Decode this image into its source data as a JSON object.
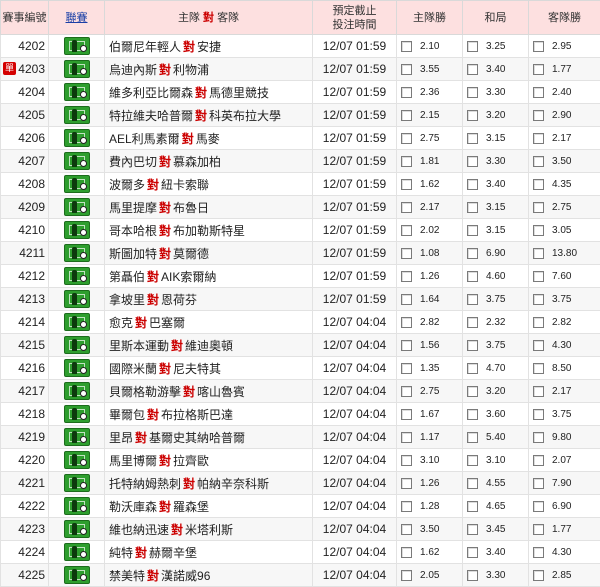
{
  "header": {
    "no": "賽事編號",
    "league": "聯賽",
    "match_pre": "主隊",
    "vs": "對",
    "match_post": "客隊",
    "time_line1": "預定截止",
    "time_line2": "投注時間",
    "home": "主隊勝",
    "draw": "和局",
    "away": "客隊勝"
  },
  "icons": {
    "league": "soccer-league-icon",
    "single": "single-match-badge"
  },
  "rows": [
    {
      "no": "4202",
      "single": "",
      "home": "伯爾尼年輕人",
      "away": "安捷",
      "time": "12/07 01:59",
      "h": "2.10",
      "d": "3.25",
      "a": "2.95"
    },
    {
      "no": "4203",
      "single": "單",
      "home": "烏迪內斯",
      "away": "利物浦",
      "time": "12/07 01:59",
      "h": "3.55",
      "d": "3.40",
      "a": "1.77"
    },
    {
      "no": "4204",
      "single": "",
      "home": "維多利亞比爾森",
      "away": "馬德里競技",
      "time": "12/07 01:59",
      "h": "2.36",
      "d": "3.30",
      "a": "2.40"
    },
    {
      "no": "4205",
      "single": "",
      "home": "特拉維夫哈普爾",
      "away": "科英布拉大學",
      "time": "12/07 01:59",
      "h": "2.15",
      "d": "3.20",
      "a": "2.90"
    },
    {
      "no": "4206",
      "single": "",
      "home": "AEL利馬素爾",
      "away": "馬麥",
      "time": "12/07 01:59",
      "h": "2.75",
      "d": "3.15",
      "a": "2.17"
    },
    {
      "no": "4207",
      "single": "",
      "home": "費內巴切",
      "away": "慕森加柏",
      "time": "12/07 01:59",
      "h": "1.81",
      "d": "3.30",
      "a": "3.50"
    },
    {
      "no": "4208",
      "single": "",
      "home": "波爾多",
      "away": "紐卡索聯",
      "time": "12/07 01:59",
      "h": "1.62",
      "d": "3.40",
      "a": "4.35"
    },
    {
      "no": "4209",
      "single": "",
      "home": "馬里提摩",
      "away": "布魯日",
      "time": "12/07 01:59",
      "h": "2.17",
      "d": "3.15",
      "a": "2.75"
    },
    {
      "no": "4210",
      "single": "",
      "home": "哥本哈根",
      "away": "布加勒斯特星",
      "time": "12/07 01:59",
      "h": "2.02",
      "d": "3.15",
      "a": "3.05"
    },
    {
      "no": "4211",
      "single": "",
      "home": "斯圖加特",
      "away": "莫爾德",
      "time": "12/07 01:59",
      "h": "1.08",
      "d": "6.90",
      "a": "13.80"
    },
    {
      "no": "4212",
      "single": "",
      "home": "第聶伯",
      "away": "AIK索爾納",
      "time": "12/07 01:59",
      "h": "1.26",
      "d": "4.60",
      "a": "7.60"
    },
    {
      "no": "4213",
      "single": "",
      "home": "拿坡里",
      "away": "恩荷芬",
      "time": "12/07 01:59",
      "h": "1.64",
      "d": "3.75",
      "a": "3.75"
    },
    {
      "no": "4214",
      "single": "",
      "home": "愈克",
      "away": "巴塞爾",
      "time": "12/07 04:04",
      "h": "2.82",
      "d": "2.32",
      "a": "2.82"
    },
    {
      "no": "4215",
      "single": "",
      "home": "里斯本運動",
      "away": "維迪奧頓",
      "time": "12/07 04:04",
      "h": "1.56",
      "d": "3.75",
      "a": "4.30"
    },
    {
      "no": "4216",
      "single": "",
      "home": "國際米蘭",
      "away": "尼夫特其",
      "time": "12/07 04:04",
      "h": "1.35",
      "d": "4.70",
      "a": "8.50"
    },
    {
      "no": "4217",
      "single": "",
      "home": "貝爾格勒游擊",
      "away": "喀山魯賓",
      "time": "12/07 04:04",
      "h": "2.75",
      "d": "3.20",
      "a": "2.17"
    },
    {
      "no": "4218",
      "single": "",
      "home": "畢爾包",
      "away": "布拉格斯巴達",
      "time": "12/07 04:04",
      "h": "1.67",
      "d": "3.60",
      "a": "3.75"
    },
    {
      "no": "4219",
      "single": "",
      "home": "里昂",
      "away": "基爾史其納哈普爾",
      "time": "12/07 04:04",
      "h": "1.17",
      "d": "5.40",
      "a": "9.80"
    },
    {
      "no": "4220",
      "single": "",
      "home": "馬里博爾",
      "away": "拉齊歐",
      "time": "12/07 04:04",
      "h": "3.10",
      "d": "3.10",
      "a": "2.07"
    },
    {
      "no": "4221",
      "single": "",
      "home": "托特納姆熱刺",
      "away": "帕納辛奈科斯",
      "time": "12/07 04:04",
      "h": "1.26",
      "d": "4.55",
      "a": "7.90"
    },
    {
      "no": "4222",
      "single": "",
      "home": "勒沃庫森",
      "away": "羅森堡",
      "time": "12/07 04:04",
      "h": "1.28",
      "d": "4.65",
      "a": "6.90"
    },
    {
      "no": "4223",
      "single": "",
      "home": "維也納迅速",
      "away": "米塔利斯",
      "time": "12/07 04:04",
      "h": "3.50",
      "d": "3.45",
      "a": "1.77"
    },
    {
      "no": "4224",
      "single": "",
      "home": "純特",
      "away": "赫爾辛堡",
      "time": "12/07 04:04",
      "h": "1.62",
      "d": "3.40",
      "a": "4.30"
    },
    {
      "no": "4225",
      "single": "",
      "home": "禁美特",
      "away": "漢諾威96",
      "time": "12/07 04:04",
      "h": "2.05",
      "d": "3.30",
      "a": "2.85"
    }
  ]
}
